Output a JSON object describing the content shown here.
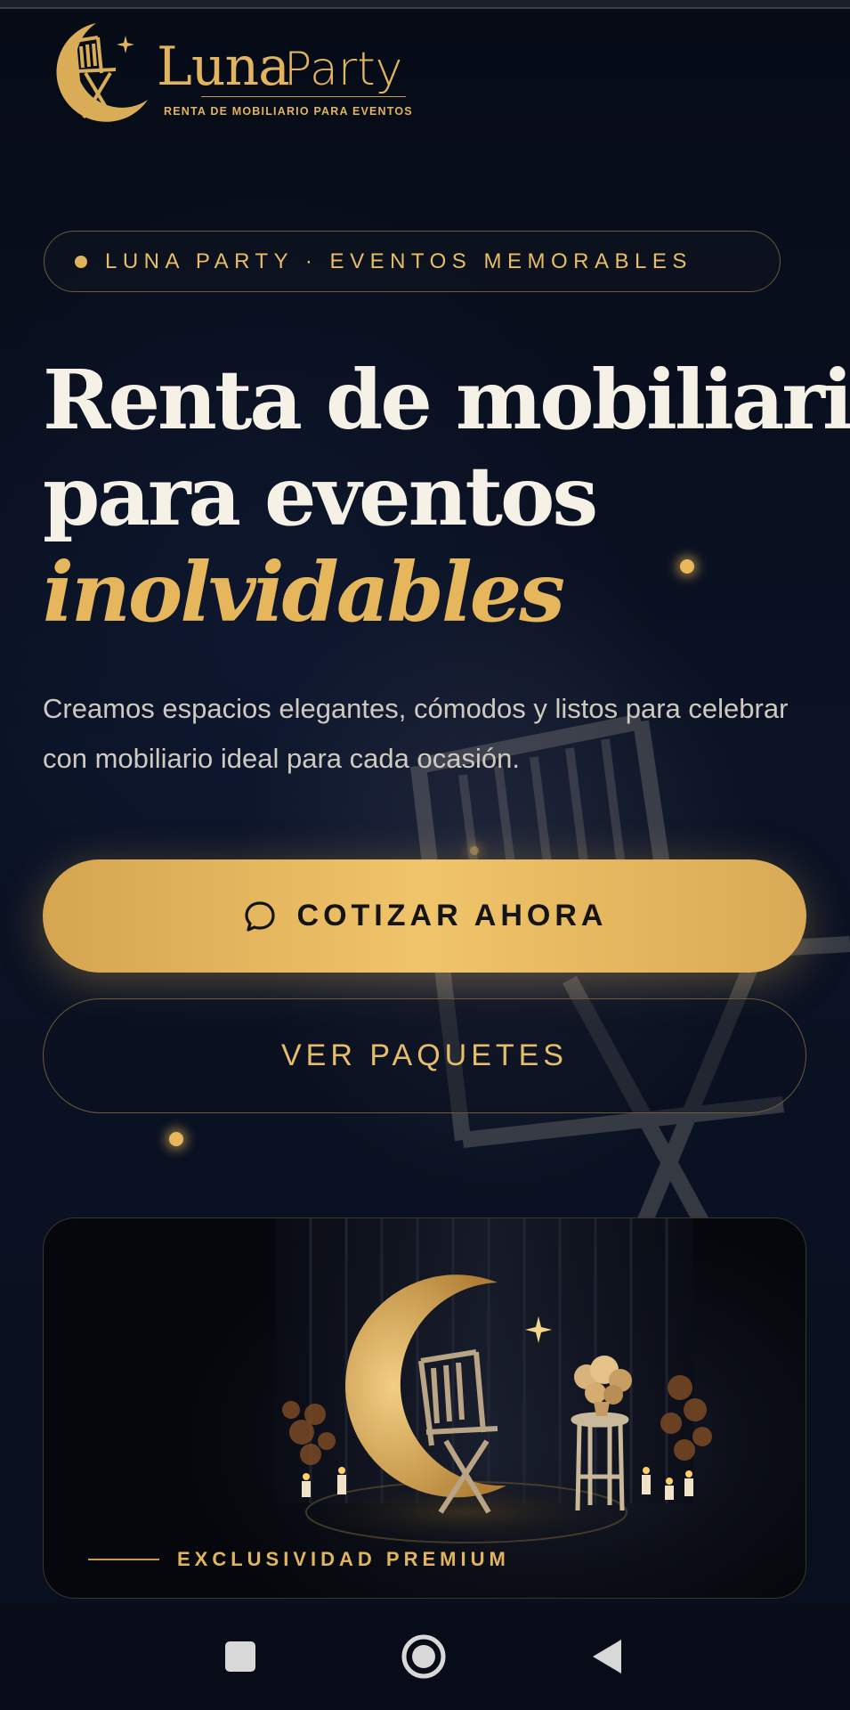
{
  "brand": {
    "name_part1": "Luna",
    "name_part2": "Party",
    "tagline": "RENTA DE MOBILIARIO PARA EVENTOS",
    "gold": "#e2b45e"
  },
  "hero": {
    "pill_text": "LUNA PARTY · EVENTOS MEMORABLES",
    "headline_line1": "Renta de mobiliario",
    "headline_line2": "para eventos",
    "headline_accent": "inolvidables",
    "description": "Creamos espacios elegantes, cómodos y listos para celebrar con mobiliario ideal para cada ocasión."
  },
  "actions": {
    "primary_label": "COTIZAR AHORA",
    "primary_icon": "chat-bubble-icon",
    "secondary_label": "VER PAQUETES"
  },
  "card": {
    "caption": "EXCLUSIVIDAD PREMIUM"
  },
  "navigation": {
    "items": [
      "recents-icon",
      "home-icon",
      "back-icon"
    ]
  },
  "colors": {
    "background": "#070d1a",
    "accent": "#e6b65c",
    "text": "#f6f1e6"
  }
}
